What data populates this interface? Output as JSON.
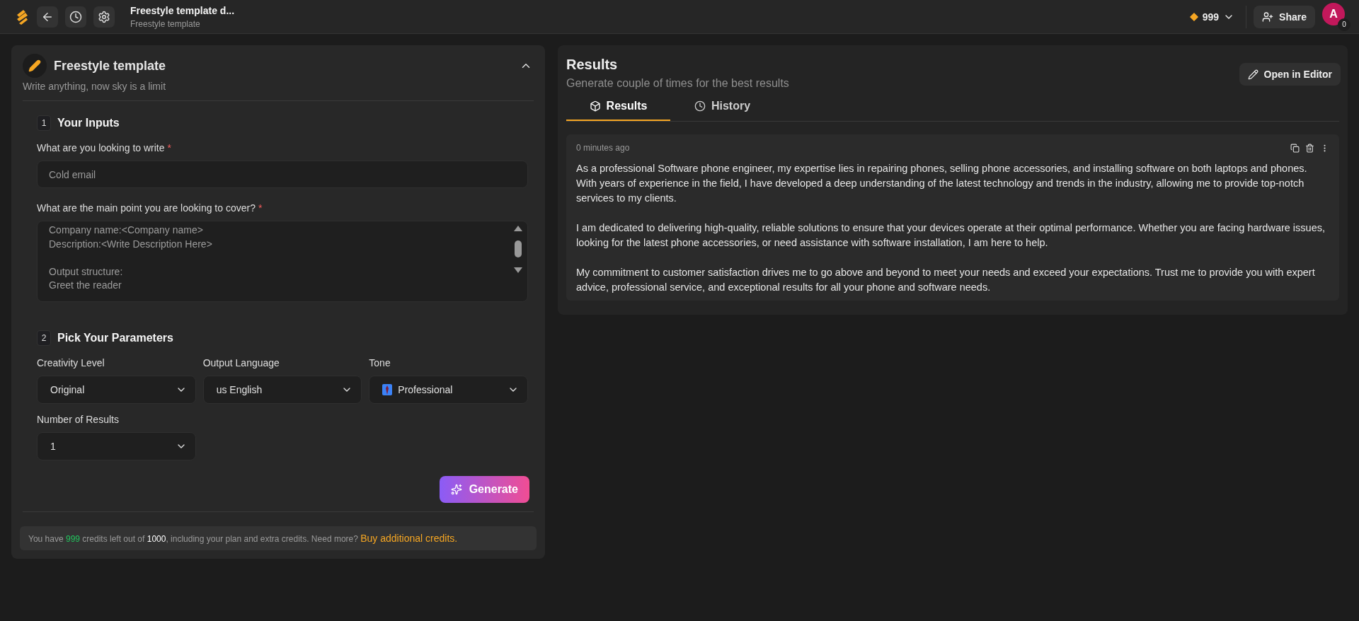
{
  "topbar": {
    "title": "Freestyle template d...",
    "subtitle": "Freestyle template",
    "credits": "999",
    "share": "Share",
    "avatar": "A",
    "avatar_badge": "0"
  },
  "template": {
    "title": "Freestyle template",
    "subtitle": "Write anything, now sky is a limit",
    "expanded": true,
    "inputs_section": {
      "number": "1",
      "title": "Your Inputs"
    },
    "fields": [
      {
        "kind": "input",
        "label": "What are you looking to write",
        "required_mark": "*",
        "placeholder": "Cold email"
      },
      {
        "kind": "textarea",
        "label": "What are the main point you are looking to cover?",
        "required_mark": "*",
        "value": "Company name:<Company name>\nDescription:<Write Description Here>\n\nOutput structure:\nGreet the reader"
      }
    ],
    "params_section": {
      "number": "2",
      "title": "Pick Your Parameters"
    },
    "params": [
      {
        "label": "Creativity Level",
        "value": "Original"
      },
      {
        "label": "Output Language",
        "value": "us English"
      },
      {
        "label": "Tone",
        "value": "Professional"
      },
      {
        "label": "Number of Results",
        "value": "1"
      }
    ],
    "generate": "Generate",
    "credits_note": {
      "prefix": "You have",
      "remaining": "999",
      "middle": "credits left out of",
      "total": "1000",
      "suffix": ", including your plan and extra credits. Need more?",
      "link": "Buy additional credits."
    }
  },
  "results": {
    "title": "Results",
    "subtitle": "Generate couple of times for the best results",
    "open_editor": "Open in Editor",
    "tabs": [
      {
        "label": "Results",
        "selected": true
      },
      {
        "label": "History",
        "selected": false
      }
    ],
    "items": [
      {
        "time": "0 minutes ago",
        "paragraphs": [
          "As a professional Software phone engineer, my expertise lies in repairing phones, selling phone accessories, and installing software on both laptops and phones. With years of experience in the field, I have developed a deep understanding of the latest technology and trends in the industry, allowing me to provide top-notch services to my clients.",
          "I am dedicated to delivering high-quality, reliable solutions to ensure that your devices operate at their optimal performance. Whether you are facing hardware issues, looking for the latest phone accessories, or need assistance with software installation, I am here to help.",
          "My commitment to customer satisfaction drives me to go above and beyond to meet your needs and exceed your expectations. Trust me to provide you with expert advice, professional service, and exceptional results for all your phone and software needs."
        ]
      }
    ]
  }
}
